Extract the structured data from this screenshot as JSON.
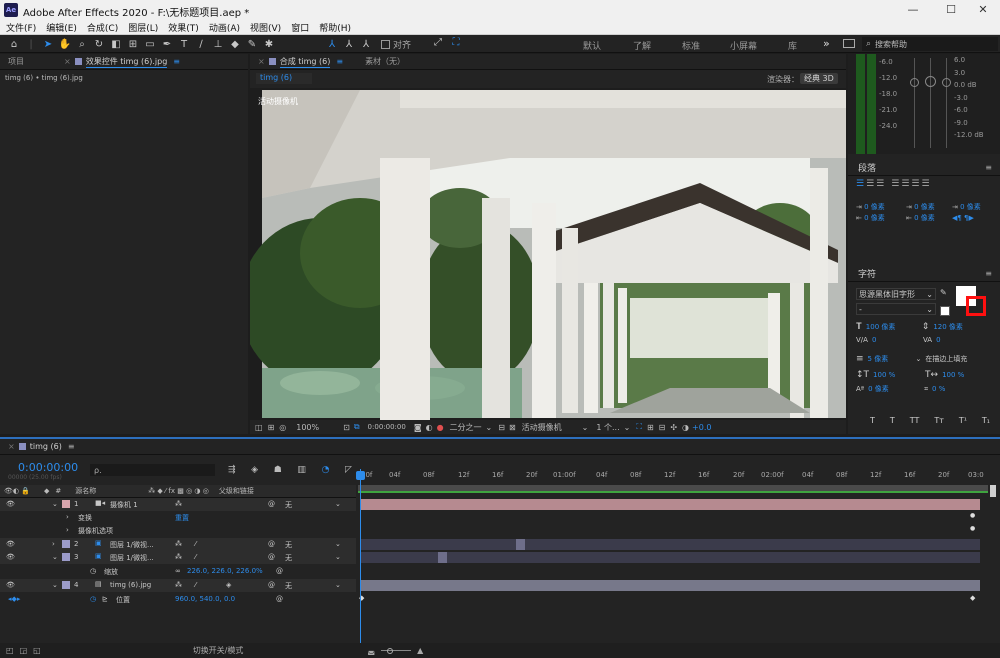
{
  "app": {
    "icon_text": "Ae",
    "title": "Adobe After Effects 2020 - F:\\无标题项目.aep *",
    "window_controls": [
      "—",
      "☐",
      "✕"
    ]
  },
  "menu": [
    "文件(F)",
    "编辑(E)",
    "合成(C)",
    "图层(L)",
    "效果(T)",
    "动画(A)",
    "视图(V)",
    "窗口",
    "帮助(H)"
  ],
  "toolbar": {
    "align_label": "对齐",
    "workspaces": [
      "默认",
      "了解",
      "标准",
      "小屏幕",
      "库"
    ],
    "more": "»",
    "search_placeholder": "搜索帮助"
  },
  "project_panel": {
    "tab_project": "项目",
    "tab_effects": "效果控件 timg (6).jpg",
    "breadcrumb": "timg (6) • timg (6).jpg"
  },
  "comp_panel": {
    "tab_comp": "合成 timg (6)",
    "tab_footage": "素材（无）",
    "comp_chip": "timg (6)",
    "renderer_label": "渲染器：",
    "renderer_value": "经典 3D",
    "camera_label": "活动摄像机",
    "bottom": {
      "zoom": "100%",
      "timecode": "0:00:00:00",
      "resolution": "二分之一",
      "camera": "活动摄像机",
      "views": "1 个...",
      "exposure": "+0.0"
    }
  },
  "audio_meter": {
    "left_scale": [
      "6.0",
      "0.0",
      "-6.0",
      "-12.0",
      "-18.0",
      "-24.0"
    ],
    "db_scale": [
      "-6.0",
      "-12.0",
      "-18.0",
      "-21.0",
      "-24.0"
    ],
    "right_scale": [
      "6.0",
      "3.0",
      "0.0 dB",
      "-3.0",
      "-6.0",
      "-9.0",
      "-12.0 dB"
    ]
  },
  "paragraph_panel": {
    "title": "段落",
    "indent_values": [
      "0 像素",
      "0 像素",
      "0 像素",
      "0 像素",
      "0 像素"
    ]
  },
  "character_panel": {
    "title": "字符",
    "font": "思源黑体旧字形",
    "style": "-",
    "size": "100 像素",
    "leading": "120 像素",
    "kerning": "0",
    "tracking": "0",
    "stroke_width": "5 像素",
    "stroke_type": "在描边上填充",
    "vscale": "100 %",
    "hscale": "100 %",
    "baseline": "0 像素",
    "tsume": "0 %",
    "styles": [
      "T",
      "T",
      "TT",
      "Tт",
      "T¹",
      "T₁"
    ]
  },
  "timeline": {
    "tab": "timg (6)",
    "timecode": "0:00:00:00",
    "fps": "00000 (25.00 fps)",
    "search_placeholder": "ρ.",
    "col_name": "源名称",
    "col_parent": "父级和链接",
    "ruler": [
      "00f",
      "04f",
      "08f",
      "12f",
      "16f",
      "20f",
      "01:00f",
      "04f",
      "08f",
      "12f",
      "16f",
      "20f",
      "02:00f",
      "04f",
      "08f",
      "12f",
      "16f",
      "20f",
      "03:0"
    ],
    "layers": [
      {
        "num": "1",
        "name": "摄像机 1",
        "parent": "无",
        "color": "#d9a6ad"
      },
      {
        "num": "2",
        "name": "图层 1/微视...",
        "parent": "无",
        "color": "#9b9bc9"
      },
      {
        "num": "3",
        "name": "图层 1/微视...",
        "parent": "无",
        "color": "#9b9bc9"
      },
      {
        "num": "4",
        "name": "timg (6).jpg",
        "parent": "无",
        "color": "#9b9bc9"
      }
    ],
    "props": {
      "transform": "变换",
      "transform_reset": "重置",
      "camera_options": "摄像机选项",
      "scale_label": "缩放",
      "scale_value": "226.0, 226.0, 226.0%",
      "position_label": "位置",
      "position_value": "960.0, 540.0, 0.0"
    },
    "footer_toggle": "切换开关/模式"
  }
}
